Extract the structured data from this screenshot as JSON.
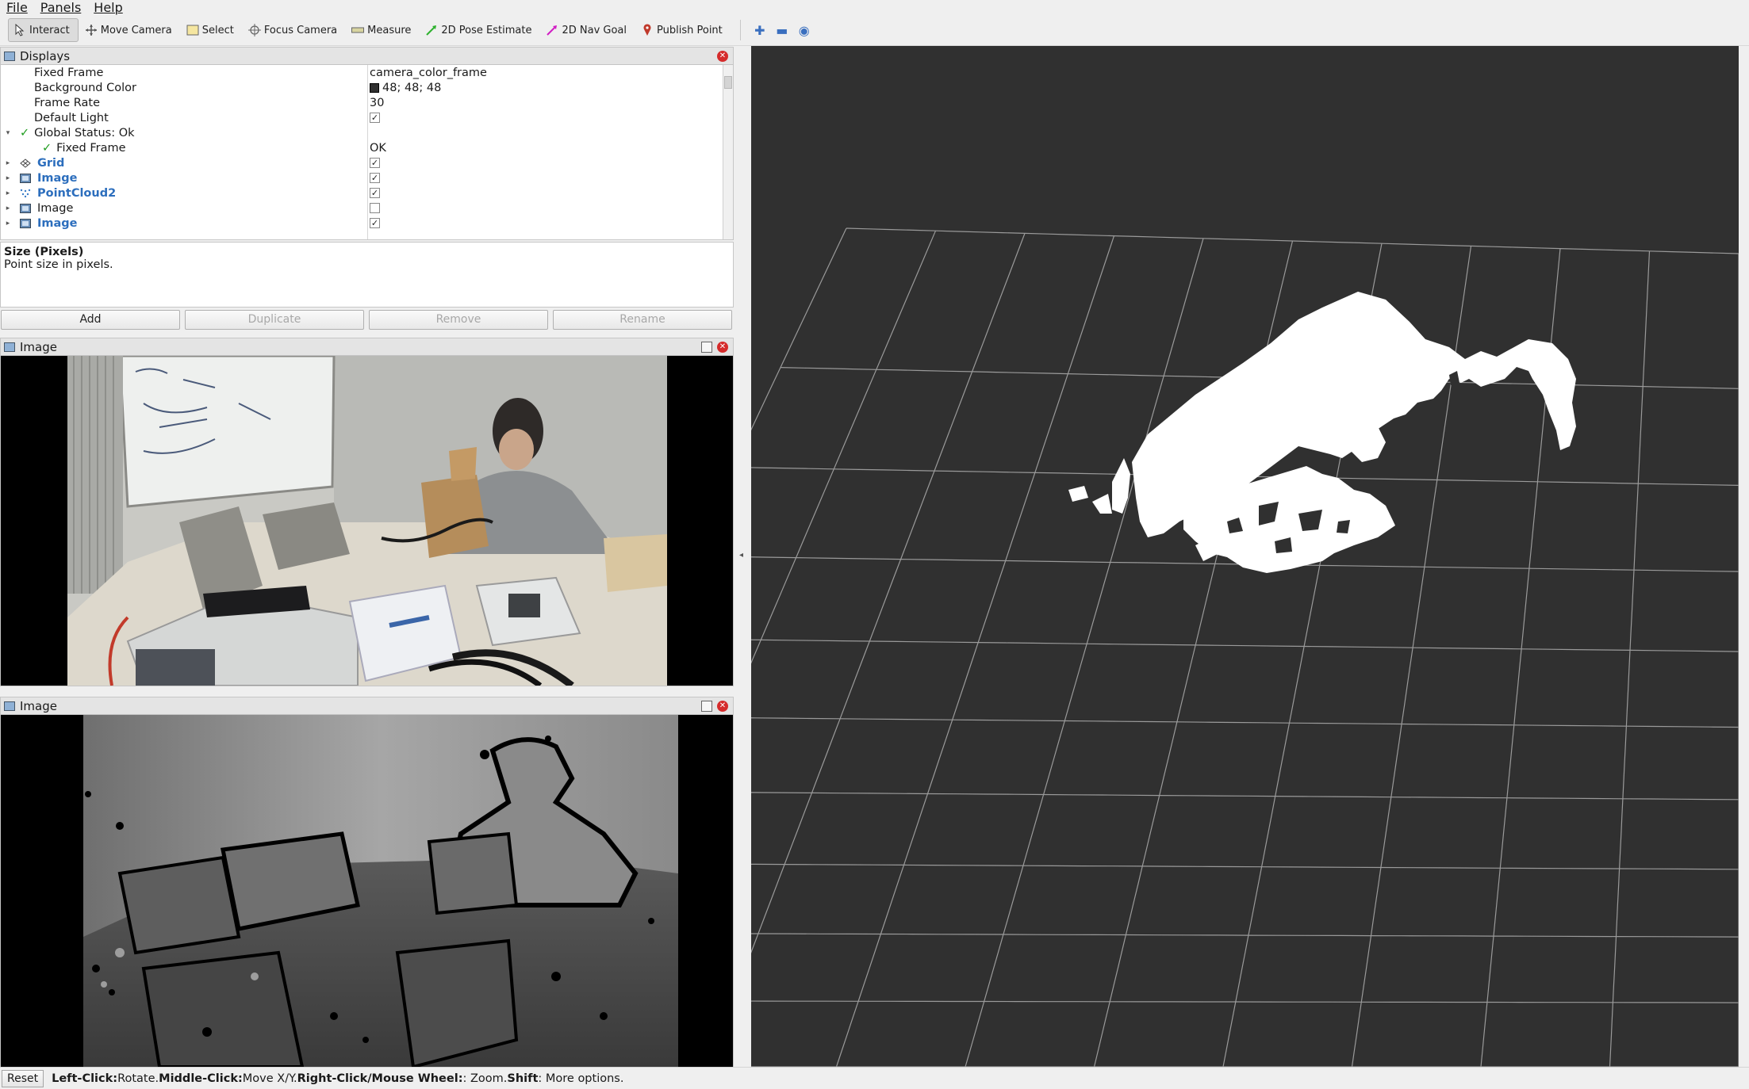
{
  "menu": [
    "File",
    "Panels",
    "Help"
  ],
  "toolbar": {
    "tools": [
      {
        "label": "Interact",
        "icon": "cursor-icon",
        "active": true
      },
      {
        "label": "Move Camera",
        "icon": "move-camera-icon",
        "active": false
      },
      {
        "label": "Select",
        "icon": "select-icon",
        "active": false
      },
      {
        "label": "Focus Camera",
        "icon": "focus-camera-icon",
        "active": false
      },
      {
        "label": "Measure",
        "icon": "ruler-icon",
        "active": false
      },
      {
        "label": "2D Pose Estimate",
        "icon": "pose-arrow-icon",
        "active": false
      },
      {
        "label": "2D Nav Goal",
        "icon": "nav-goal-arrow-icon",
        "active": false
      },
      {
        "label": "Publish Point",
        "icon": "map-pin-icon",
        "active": false
      }
    ],
    "extra_icons": [
      "plus-icon",
      "minus-icon",
      "eye-icon"
    ]
  },
  "displays": {
    "title": "Displays",
    "rows": [
      {
        "indent": 1,
        "arrow": "",
        "check": "",
        "label": "Fixed Frame",
        "value": "camera_color_frame"
      },
      {
        "indent": 1,
        "arrow": "",
        "check": "",
        "label": "Background Color",
        "value": "48; 48; 48",
        "swatch": "#303030"
      },
      {
        "indent": 1,
        "arrow": "",
        "check": "",
        "label": "Frame Rate",
        "value": "30"
      },
      {
        "indent": 1,
        "arrow": "",
        "check": "",
        "label": "Default Light",
        "value_checkbox": true
      },
      {
        "indent": 0,
        "arrow": "▾",
        "check": "✓",
        "label": "Global Status: Ok",
        "value": ""
      },
      {
        "indent": 1,
        "arrow": "",
        "check": "✓",
        "label": "Fixed Frame",
        "value": "OK"
      },
      {
        "indent": 0,
        "arrow": "▸",
        "icon": "grid-icon",
        "label": "Grid",
        "bold": true,
        "value_checkbox": true
      },
      {
        "indent": 0,
        "arrow": "▸",
        "icon": "image-icon",
        "label": "Image",
        "bold": true,
        "value_checkbox": true
      },
      {
        "indent": 0,
        "arrow": "▸",
        "icon": "pointcloud-icon",
        "label": "PointCloud2",
        "bold": true,
        "value_checkbox": true
      },
      {
        "indent": 0,
        "arrow": "▸",
        "icon": "image-icon",
        "label": "Image",
        "bold": false,
        "value_checkbox": false
      },
      {
        "indent": 0,
        "arrow": "▸",
        "icon": "image-icon",
        "label": "Image",
        "bold": true,
        "value_checkbox": true
      }
    ]
  },
  "description": {
    "title": "Size (Pixels)",
    "text": "Point size in pixels."
  },
  "buttons": {
    "add": "Add",
    "duplicate": "Duplicate",
    "remove": "Remove",
    "rename": "Rename"
  },
  "image_panels": [
    {
      "title": "Image"
    },
    {
      "title": "Image"
    }
  ],
  "statusbar": {
    "reset": "Reset",
    "hints": [
      {
        "key": "Left-Click:",
        "text": " Rotate. "
      },
      {
        "key": "Middle-Click:",
        "text": " Move X/Y. "
      },
      {
        "key": "Right-Click/Mouse Wheel:",
        "text": ": Zoom. "
      },
      {
        "key": "Shift",
        "text": ": More options."
      }
    ]
  },
  "colors": {
    "background": "#303030",
    "grid": "#9a9a9a",
    "pointcloud": "#ffffff",
    "link_blue": "#2c6ebd",
    "ok_green": "#1f9d1f"
  }
}
